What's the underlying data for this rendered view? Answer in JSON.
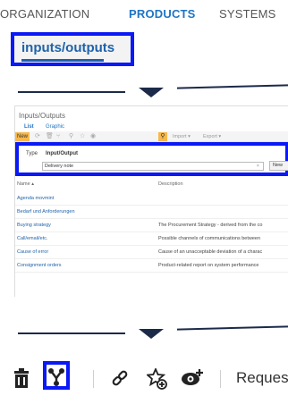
{
  "nav": {
    "tabs": [
      {
        "label": "ORGANIZATION",
        "active": false
      },
      {
        "label": "PRODUCTS",
        "active": true
      },
      {
        "label": "SYSTEMS",
        "active": false
      }
    ],
    "sub_tab": "inputs/outputs"
  },
  "screen": {
    "title": "Inputs/Outputs",
    "view_tabs": [
      "List",
      "Graphic"
    ],
    "toolbar": {
      "new_label": "New",
      "import_label": "Import ▾",
      "export_label": "Export ▾",
      "search_icon": "search-icon"
    },
    "filter": {
      "type_label": "Type",
      "type_value": "Input/Output",
      "input_value": "Delivery note",
      "clear_glyph": "×",
      "button_label": "New"
    },
    "columns": [
      "Name ▴",
      "Description"
    ],
    "rows": [
      {
        "name": "Agenda movmint",
        "description": ""
      },
      {
        "name": "Bedarf und Anforderungen",
        "description": ""
      },
      {
        "name": "Buying strategy",
        "description": "The Procurement Strategy - derived from the co"
      },
      {
        "name": "Call/email/etc.",
        "description": "Possible channels of communications between"
      },
      {
        "name": "Cause of error",
        "description": "Cause of an unacceptable deviation of a charac"
      },
      {
        "name": "Consignment orders",
        "description": "Product-related report on system performance"
      }
    ]
  },
  "bottom_toolbar": {
    "icons": [
      "trash-icon",
      "hierarchy-icon",
      "link-icon",
      "favorite-add-icon",
      "watch-add-icon"
    ],
    "highlighted_icon": "hierarchy-icon",
    "request_label": "Request"
  },
  "colors": {
    "highlight": "#0a19f5",
    "accent": "#1f74c4",
    "new_button": "#f6b84c"
  }
}
